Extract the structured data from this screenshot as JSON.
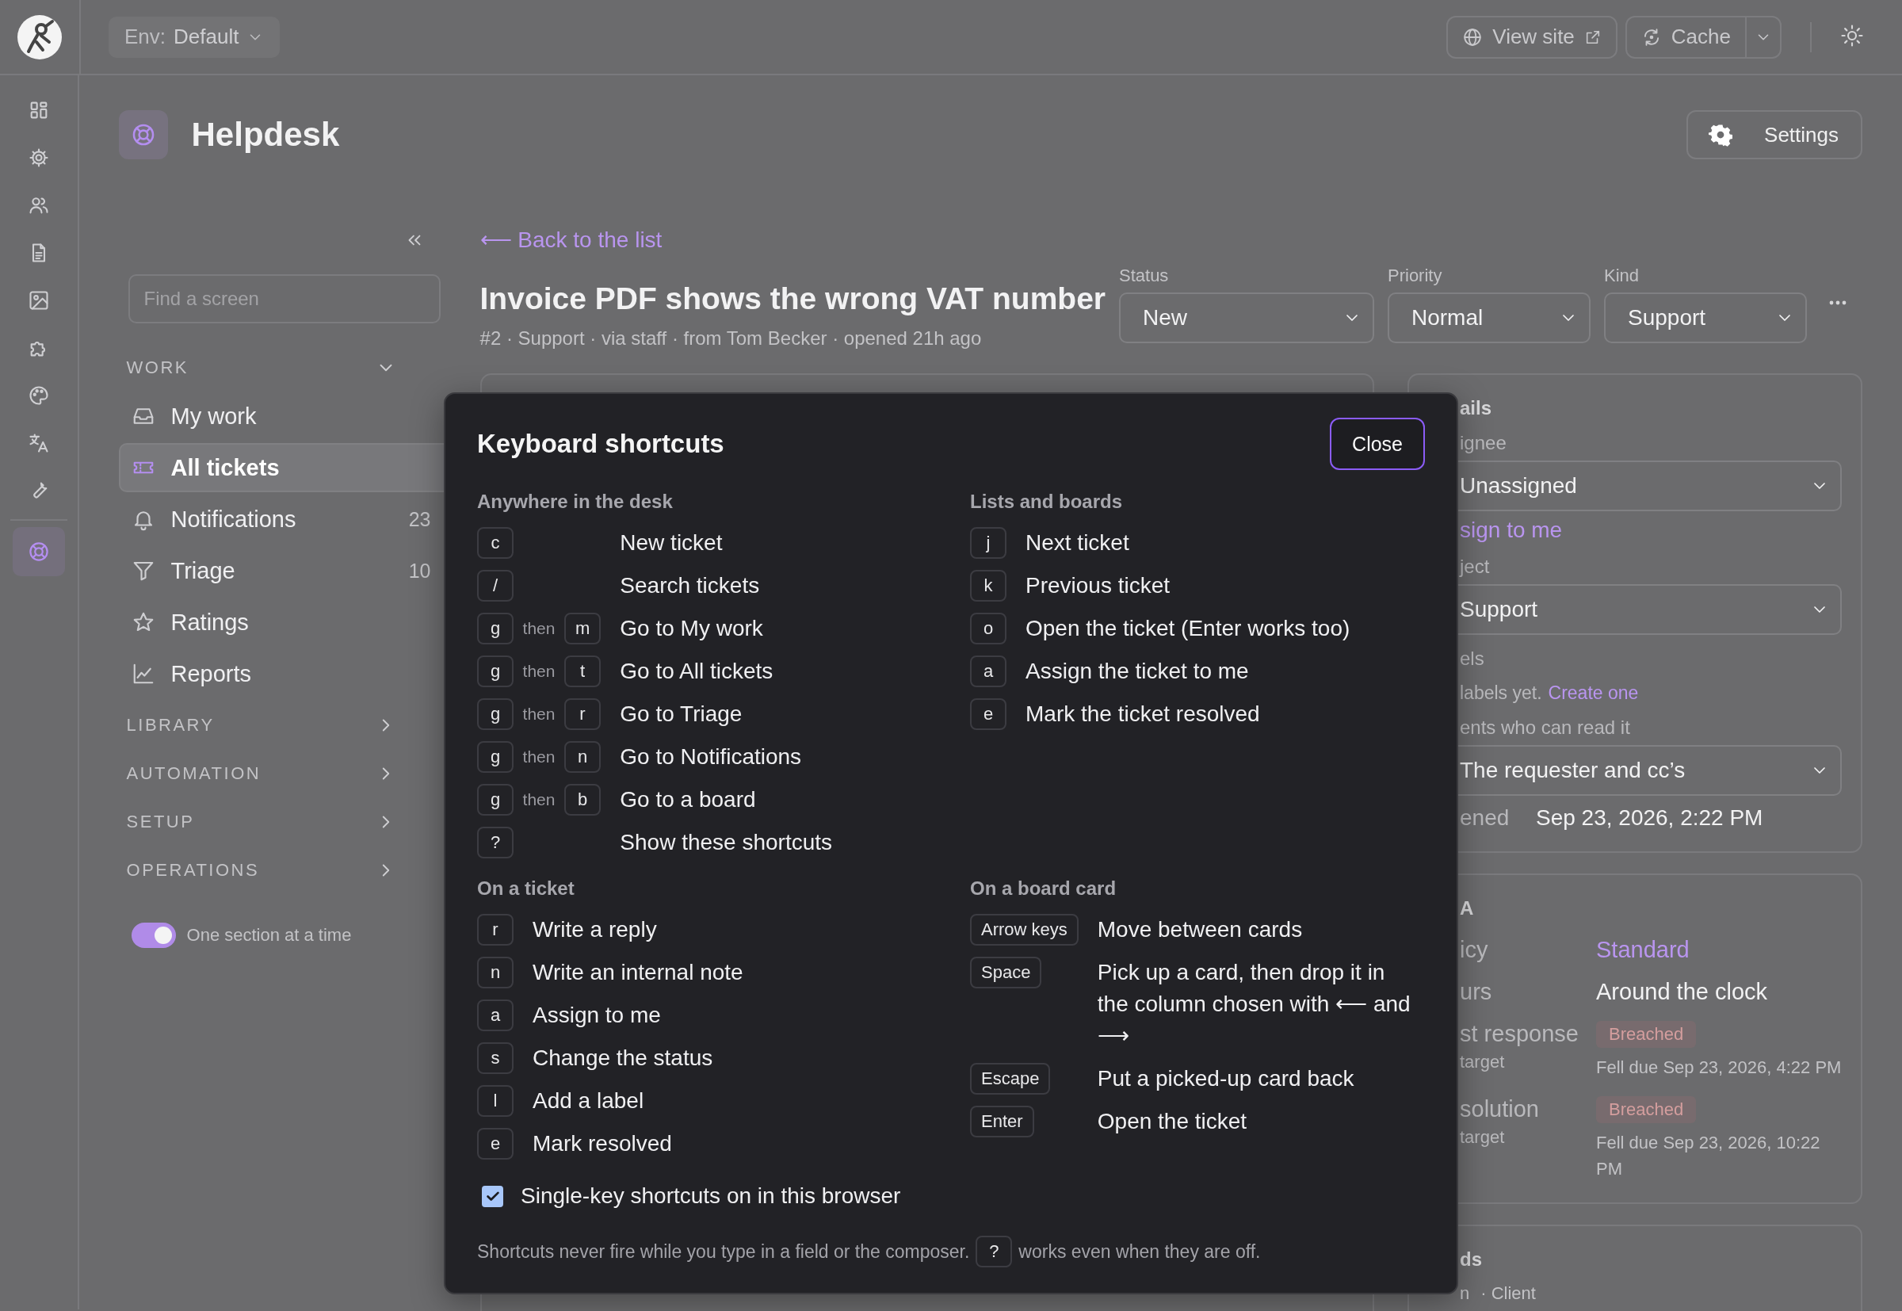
{
  "topbar": {
    "env_label": "Env:",
    "env_value": "Default",
    "view_site": "View site",
    "cache": "Cache"
  },
  "rail": [
    {
      "selected": false
    },
    {
      "selected": false
    },
    {
      "selected": false
    },
    {
      "selected": false
    },
    {
      "selected": false
    },
    {
      "selected": false
    },
    {
      "selected": false
    },
    {
      "selected": false
    },
    {
      "selected": false
    },
    {
      "selected": true
    }
  ],
  "page": {
    "title": "Helpdesk",
    "settings": "Settings"
  },
  "sidebar": {
    "search_placeholder": "Find a screen",
    "groups": [
      {
        "label": "WORK",
        "expanded": true,
        "items": [
          {
            "label": "My work",
            "selected": false
          },
          {
            "label": "All tickets",
            "selected": true
          },
          {
            "label": "Notifications",
            "count": "23",
            "selected": false
          },
          {
            "label": "Triage",
            "count": "10",
            "selected": false
          },
          {
            "label": "Ratings",
            "selected": false
          },
          {
            "label": "Reports",
            "selected": false
          }
        ]
      },
      {
        "label": "LIBRARY",
        "expanded": false
      },
      {
        "label": "AUTOMATION",
        "expanded": false
      },
      {
        "label": "SETUP",
        "expanded": false
      },
      {
        "label": "OPERATIONS",
        "expanded": false
      }
    ],
    "toggle": {
      "label": "One section at a time",
      "on": true
    }
  },
  "ticket": {
    "back": "⟵ Back to the list",
    "title": "Invoice PDF shows the wrong VAT number",
    "meta": "#2 · Support · via staff · from Tom Becker · opened 21h ago",
    "fields": [
      {
        "label": "Status",
        "value": "New"
      },
      {
        "label": "Priority",
        "value": "Normal"
      },
      {
        "label": "Kind",
        "value": "Support"
      }
    ]
  },
  "details_card": {
    "heading": "ails",
    "fields": [
      {
        "kind": "select",
        "label": "ignee",
        "value": "Unassigned"
      },
      {
        "kind": "link",
        "text": "sign to me"
      },
      {
        "kind": "select",
        "label": "ject",
        "value": "Support"
      },
      {
        "kind": "note",
        "label": "els",
        "text": "labels yet.",
        "link": "Create one"
      },
      {
        "kind": "select",
        "label": "ents who can read it",
        "value": "The requester and cc’s"
      },
      {
        "kind": "pair",
        "label": "ened",
        "value": "Sep 23, 2026, 2:22 PM"
      }
    ]
  },
  "sla_card": {
    "heading": "A",
    "rows": [
      {
        "kind": "link",
        "label": "icy",
        "value": "Standard"
      },
      {
        "kind": "text",
        "label": "urs",
        "value": "Around the clock"
      },
      {
        "kind": "breach",
        "label": "st response",
        "sublabel": "target",
        "badge": "Breached",
        "value": "Fell due Sep 23, 2026, 4:22 PM"
      },
      {
        "kind": "breach",
        "label": "solution",
        "sublabel": "target",
        "badge": "Breached",
        "value": "Fell due Sep 23, 2026, 10:22 PM"
      }
    ]
  },
  "third_card": {
    "heading": "ds",
    "items": [
      "n",
      "· Client"
    ]
  },
  "modal": {
    "title": "Keyboard shortcuts",
    "close": "Close",
    "sections": [
      {
        "heading": "Anywhere in the desk",
        "rows": [
          {
            "key": "c",
            "action": "New ticket"
          },
          {
            "key": "/",
            "action": "Search tickets"
          },
          {
            "key": "g",
            "then": "then",
            "key2": "m",
            "action": "Go to My work"
          },
          {
            "key": "g",
            "then": "then",
            "key2": "t",
            "action": "Go to All tickets"
          },
          {
            "key": "g",
            "then": "then",
            "key2": "r",
            "action": "Go to Triage"
          },
          {
            "key": "g",
            "then": "then",
            "key2": "n",
            "action": "Go to Notifications"
          },
          {
            "key": "g",
            "then": "then",
            "key2": "b",
            "action": "Go to a board"
          },
          {
            "key": "?",
            "action": "Show these shortcuts"
          }
        ]
      },
      {
        "heading": "Lists and boards",
        "rows": [
          {
            "key": "j",
            "action": "Next ticket"
          },
          {
            "key": "k",
            "action": "Previous ticket"
          },
          {
            "key": "o",
            "action": "Open the ticket (Enter works too)"
          },
          {
            "key": "a",
            "action": "Assign the ticket to me"
          },
          {
            "key": "e",
            "action": "Mark the ticket resolved"
          }
        ]
      },
      {
        "heading": "On a ticket",
        "rows": [
          {
            "key": "r",
            "action": "Write a reply"
          },
          {
            "key": "n",
            "action": "Write an internal note"
          },
          {
            "key": "a",
            "action": "Assign to me"
          },
          {
            "key": "s",
            "action": "Change the status"
          },
          {
            "key": "l",
            "action": "Add a label"
          },
          {
            "key": "e",
            "action": "Mark resolved"
          }
        ]
      },
      {
        "heading": "On a board card",
        "rows": [
          {
            "key": "Arrow keys",
            "action": "Move between cards"
          },
          {
            "key": "Space",
            "action": "Pick up a card, then drop it in the column chosen with ⟵ and ⟶"
          },
          {
            "key": "Escape",
            "action": "Put a picked-up card back"
          },
          {
            "key": "Enter",
            "action": "Open the ticket"
          }
        ]
      }
    ],
    "checkbox": {
      "label": "Single-key shortcuts on in this browser",
      "checked": true
    },
    "footnote": {
      "before": "Shortcuts never fire while you type in a field or the composer.",
      "key": "?",
      "after": "works even when they are off."
    }
  }
}
